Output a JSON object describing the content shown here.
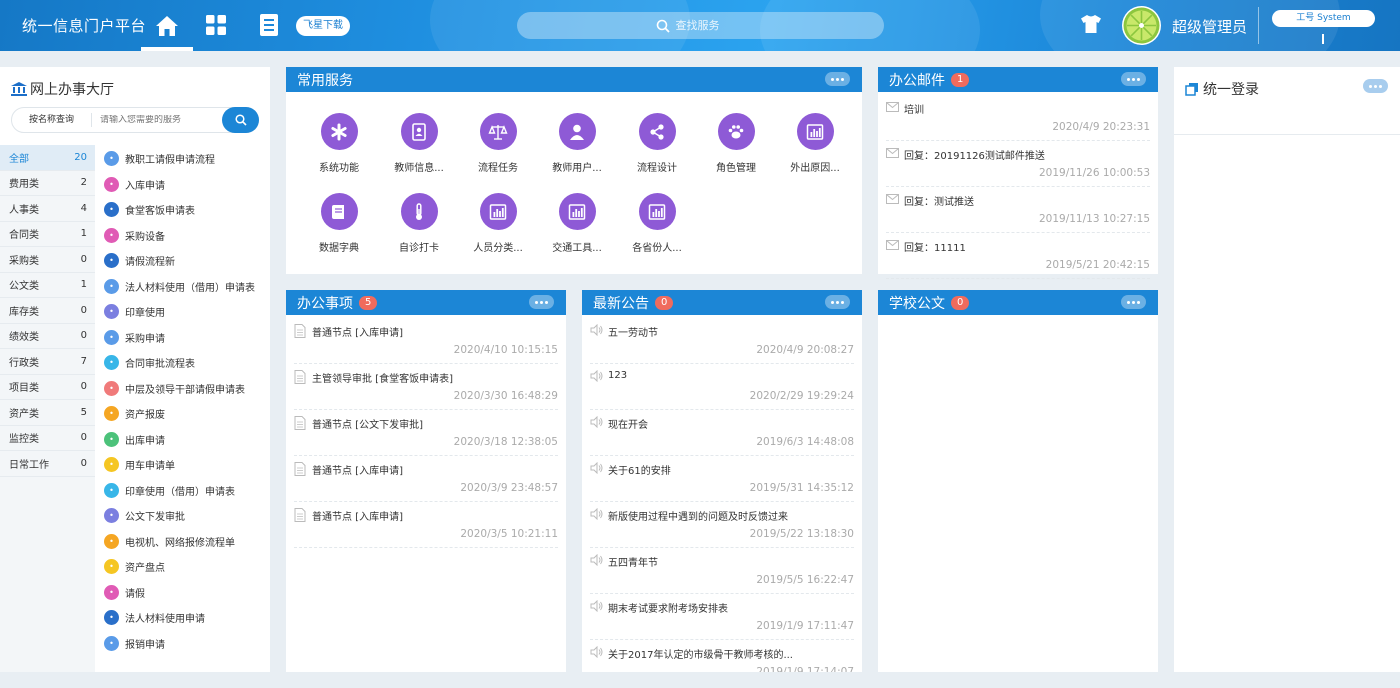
{
  "header": {
    "app_title": "统一信息门户平台",
    "download_label": "飞星下载",
    "search_placeholder": "查找服务",
    "user_name": "超级管理员",
    "job_label": "工号 System"
  },
  "hall": {
    "title": "网上办事大厅",
    "search_mode": "按名称查询",
    "search_placeholder": "请输入您需要的服务",
    "categories": [
      {
        "label": "全部",
        "count": "20"
      },
      {
        "label": "费用类",
        "count": "2"
      },
      {
        "label": "人事类",
        "count": "4"
      },
      {
        "label": "合同类",
        "count": "1"
      },
      {
        "label": "采购类",
        "count": "0"
      },
      {
        "label": "公文类",
        "count": "1"
      },
      {
        "label": "库存类",
        "count": "0"
      },
      {
        "label": "绩效类",
        "count": "0"
      },
      {
        "label": "行政类",
        "count": "7"
      },
      {
        "label": "项目类",
        "count": "0"
      },
      {
        "label": "资产类",
        "count": "5"
      },
      {
        "label": "监控类",
        "count": "0"
      },
      {
        "label": "日常工作",
        "count": "0"
      }
    ],
    "services": [
      {
        "label": "教职工请假申请流程",
        "color": "#5a9be8"
      },
      {
        "label": "入库申请",
        "color": "#e05bb5"
      },
      {
        "label": "食堂客饭申请表",
        "color": "#2a6fc9"
      },
      {
        "label": "采购设备",
        "color": "#e05bb5"
      },
      {
        "label": "请假流程新",
        "color": "#2a6fc9"
      },
      {
        "label": "法人材料使用（借用）申请表",
        "color": "#5a9be8"
      },
      {
        "label": "印章使用",
        "color": "#7b7fe0"
      },
      {
        "label": "采购申请",
        "color": "#5a9be8"
      },
      {
        "label": "合同审批流程表",
        "color": "#38b6e8"
      },
      {
        "label": "中层及领导干部请假申请表",
        "color": "#f07a7a"
      },
      {
        "label": "资产报废",
        "color": "#f5a623"
      },
      {
        "label": "出库申请",
        "color": "#4cc27a"
      },
      {
        "label": "用车申请单",
        "color": "#f5c623"
      },
      {
        "label": "印章使用（借用）申请表",
        "color": "#38b6e8"
      },
      {
        "label": "公文下发审批",
        "color": "#7b7fe0"
      },
      {
        "label": "电视机、网络报修流程单",
        "color": "#f5a623"
      },
      {
        "label": "资产盘点",
        "color": "#f5c623"
      },
      {
        "label": "请假",
        "color": "#e05bb5"
      },
      {
        "label": "法人材料使用申请",
        "color": "#2a6fc9"
      },
      {
        "label": "报销申请",
        "color": "#5a9be8"
      }
    ]
  },
  "common_services": {
    "title": "常用服务",
    "tiles": [
      {
        "label": "系统功能",
        "icon": "asterisk-icon"
      },
      {
        "label": "教师信息...",
        "icon": "contact-book-icon"
      },
      {
        "label": "流程任务",
        "icon": "scales-icon"
      },
      {
        "label": "教师用户...",
        "icon": "user-icon"
      },
      {
        "label": "流程设计",
        "icon": "share-icon"
      },
      {
        "label": "角色管理",
        "icon": "paw-icon"
      },
      {
        "label": "外出原因...",
        "icon": "bar-chart-icon"
      },
      {
        "label": "数据字典",
        "icon": "book-icon"
      },
      {
        "label": "自诊打卡",
        "icon": "thermometer-icon"
      },
      {
        "label": "人员分类...",
        "icon": "bar-chart-icon"
      },
      {
        "label": "交通工具...",
        "icon": "bar-chart-icon"
      },
      {
        "label": "各省份人...",
        "icon": "bar-chart-icon"
      }
    ]
  },
  "mail": {
    "title": "办公邮件",
    "count": "1",
    "items": [
      {
        "title": "培训",
        "date": "2020/4/9 20:23:31"
      },
      {
        "title": "回复：20191126测试邮件推送",
        "date": "2019/11/26 10:00:53"
      },
      {
        "title": "回复：测试推送",
        "date": "2019/11/13 10:27:15"
      },
      {
        "title": "回复：11111",
        "date": "2019/5/21 20:42:15"
      }
    ]
  },
  "login": {
    "title": "统一登录"
  },
  "tasks": {
    "title": "办公事项",
    "count": "5",
    "items": [
      {
        "title": "普通节点 [入库申请]",
        "date": "2020/4/10 10:15:15"
      },
      {
        "title": "主管领导审批 [食堂客饭申请表]",
        "date": "2020/3/30 16:48:29"
      },
      {
        "title": "普通节点 [公文下发审批]",
        "date": "2020/3/18 12:38:05"
      },
      {
        "title": "普通节点 [入库申请]",
        "date": "2020/3/9 23:48:57"
      },
      {
        "title": "普通节点 [入库申请]",
        "date": "2020/3/5 10:21:11"
      }
    ]
  },
  "notices": {
    "title": "最新公告",
    "count": "0",
    "items": [
      {
        "title": "五一劳动节",
        "date": "2020/4/9 20:08:27"
      },
      {
        "title": "123",
        "date": "2020/2/29 19:29:24"
      },
      {
        "title": "现在开会",
        "date": "2019/6/3 14:48:08"
      },
      {
        "title": "关于61的安排",
        "date": "2019/5/31 14:35:12"
      },
      {
        "title": "新版使用过程中遇到的问题及时反馈过来",
        "date": "2019/5/22 13:18:30"
      },
      {
        "title": "五四青年节",
        "date": "2019/5/5 16:22:47"
      },
      {
        "title": "期末考试要求附考场安排表",
        "date": "2019/1/9 17:11:47"
      },
      {
        "title": "关于2017年认定的市级骨干教师考核的...",
        "date": "2019/1/9 17:14:07"
      }
    ]
  },
  "docs": {
    "title": "学校公文",
    "count": "0"
  }
}
